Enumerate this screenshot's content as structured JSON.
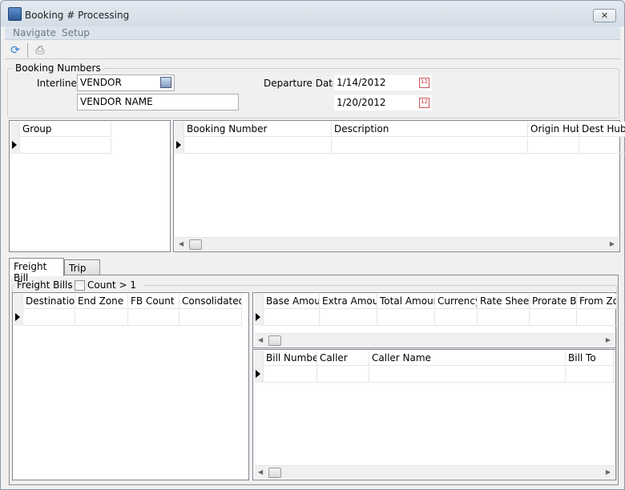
{
  "window": {
    "title": "Booking # Processing",
    "close_icon": "close-icon"
  },
  "menu": [
    "Navigate",
    "Setup"
  ],
  "toolbar": {
    "refresh_icon": "refresh-icon",
    "print_icon": "print-icon"
  },
  "booking_numbers": {
    "group_title": "Booking Numbers",
    "interliner_label": "Interliner",
    "interliner_value": "VENDOR",
    "vendor_name": "VENDOR NAME",
    "departure_label": "Departure Date",
    "date_from": "1/14/2012",
    "date_to": "1/20/2012"
  },
  "group_grid": {
    "columns": [
      "Group"
    ]
  },
  "booking_grid": {
    "columns": [
      "Booking Number",
      "Description",
      "Origin Hub",
      "Dest Hub"
    ]
  },
  "tabs": [
    {
      "label": "Freight Bill",
      "active": true
    },
    {
      "label": "Trip",
      "active": false
    }
  ],
  "freight_bills": {
    "group_title": "Freight Bills",
    "count_label": "Count > 1",
    "count_checked": false
  },
  "dest_grid": {
    "columns": [
      "Destination",
      "End Zone",
      "FB Count",
      "Consolidated I"
    ]
  },
  "amount_grid": {
    "columns": [
      "Base Amoun",
      "Extra Amoun",
      "Total Amour",
      "Currency",
      "Rate Sheet",
      "Prorate By",
      "From Zo"
    ]
  },
  "bill_grid": {
    "columns": [
      "Bill Number",
      "Caller",
      "Caller Name",
      "Bill To"
    ]
  }
}
